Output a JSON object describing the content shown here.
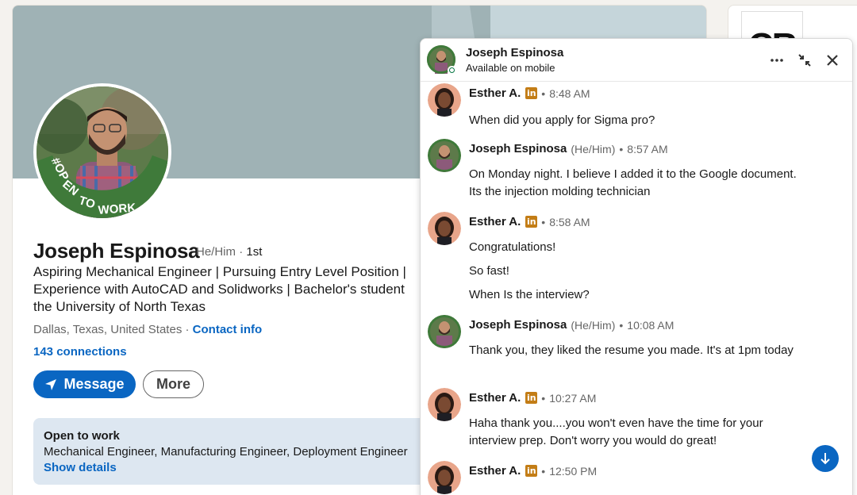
{
  "profile": {
    "name": "Joseph Espinosa",
    "pronouns": "He/Him",
    "degree": "1st",
    "headline_lines": [
      "Aspiring Mechanical Engineer | Pursuing Entry Level Position |",
      "Experience with AutoCAD and Solidworks | Bachelor's student",
      "the University of North Texas"
    ],
    "location": "Dallas, Texas, United States",
    "contact_info": "Contact info",
    "connections": "143 connections",
    "message_button": "Message",
    "more_button": "More",
    "open_to_work": {
      "title": "Open to work",
      "roles": "Mechanical Engineer, Manufacturing Engineer, Deployment Engineer",
      "link": "Show details"
    },
    "avatar_frame_text": "#OPENTOWORK"
  },
  "sidebar": {
    "logo_text": "CR"
  },
  "chat": {
    "contact_name": "Joseph Espinosa",
    "status": "Available on mobile",
    "messages": [
      {
        "sender": "Esther A.",
        "pronouns": "",
        "badge": "in",
        "time": "8:48 AM",
        "lines": [
          "When did you apply for Sigma pro?"
        ]
      },
      {
        "sender": "Joseph Espinosa",
        "pronouns": "(He/Him)",
        "badge": "",
        "time": "8:57 AM",
        "lines": [
          "On Monday night. I believe I added it to the Google document. Its the injection molding technician"
        ]
      },
      {
        "sender": "Esther A.",
        "pronouns": "",
        "badge": "in",
        "time": "8:58 AM",
        "lines": [
          "Congratulations!",
          "So fast!",
          "When Is the interview?"
        ]
      },
      {
        "sender": "Joseph Espinosa",
        "pronouns": "(He/Him)",
        "badge": "",
        "time": "10:08 AM",
        "lines": [
          "Thank you, they liked the resume you made. It's at 1pm today"
        ]
      },
      {
        "sender": "Esther A.",
        "pronouns": "",
        "badge": "in",
        "time": "10:27 AM",
        "lines": [
          "Haha thank you....you won't even have the time for your interview prep. Don't worry you would do great!"
        ]
      },
      {
        "sender": "Esther A.",
        "pronouns": "",
        "badge": "in",
        "time": "12:50 PM",
        "lines": []
      }
    ]
  },
  "colors": {
    "brand_blue": "#0a66c2",
    "online_green": "#057642",
    "banner": "#9fb2b5",
    "open_to_work_bg": "#dde7f1"
  }
}
